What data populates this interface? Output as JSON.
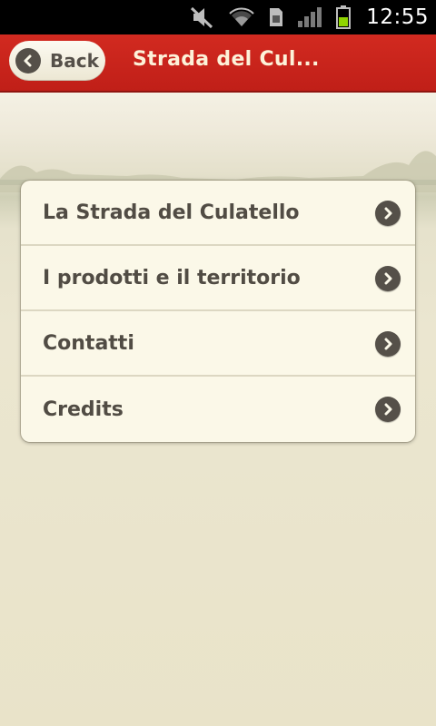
{
  "status_bar": {
    "icons": [
      "mute-icon",
      "wifi-icon",
      "sim-icon",
      "signal-icon",
      "battery-icon"
    ],
    "time": "12:55"
  },
  "header": {
    "back_label": "Back",
    "title": "Strada del Cul...",
    "color": "#c8241c"
  },
  "menu": {
    "items": [
      {
        "label": "La Strada del Culatello"
      },
      {
        "label": "I prodotti e il territorio"
      },
      {
        "label": "Contatti"
      },
      {
        "label": "Credits"
      }
    ]
  }
}
